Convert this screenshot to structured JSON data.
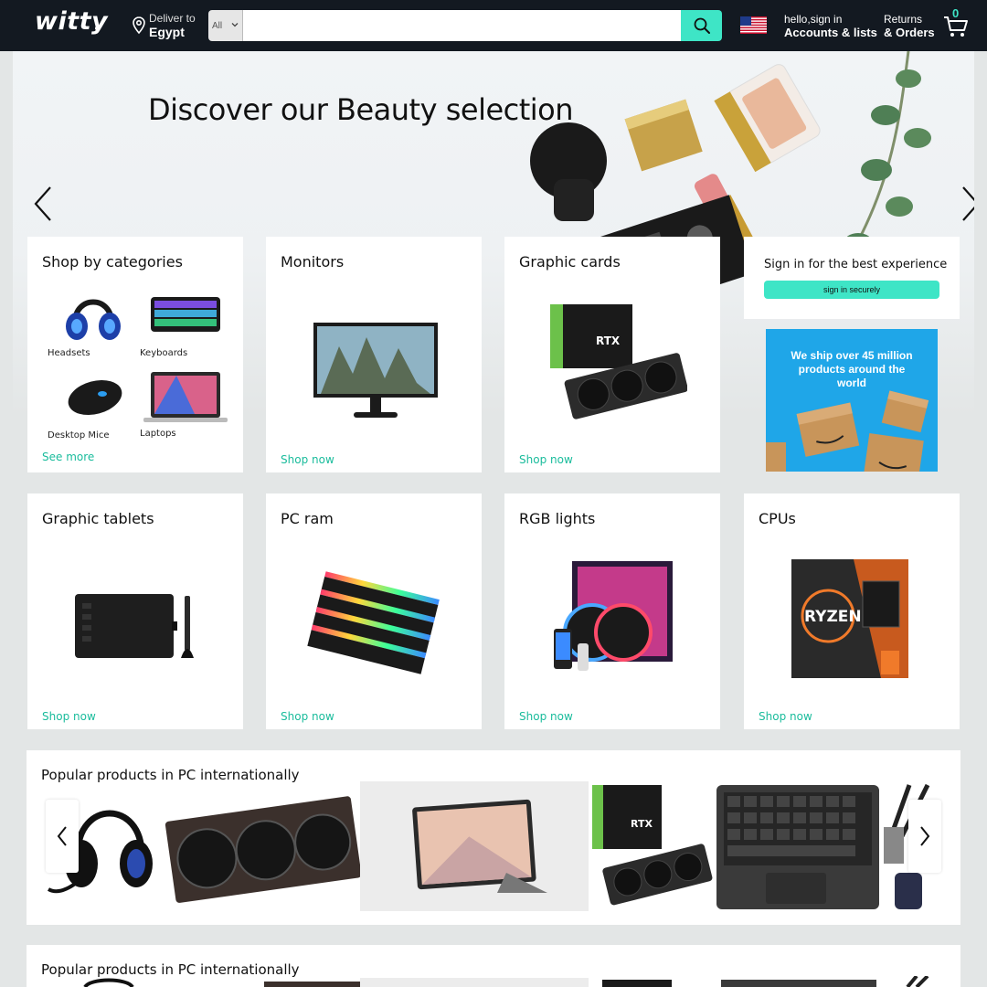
{
  "header": {
    "logo": "witty",
    "deliver_line1": "Deliver to",
    "deliver_line2": "Egypt",
    "search_category": "All",
    "search_placeholder": "",
    "account_line1": "hello,sign in",
    "account_line2": "Accounts & lists",
    "returns_line1": "Returns",
    "returns_line2": "& Orders",
    "cart_count": "0",
    "accent_color": "#3ee5c6"
  },
  "hero": {
    "title": "Discover our Beauty selection"
  },
  "categories_card": {
    "title": "Shop by categories",
    "items": [
      {
        "label": "Headsets",
        "icon": "headset-icon"
      },
      {
        "label": "Keyboards",
        "icon": "keyboard-icon"
      },
      {
        "label": "Desktop Mice",
        "icon": "mouse-icon"
      },
      {
        "label": "Laptops",
        "icon": "laptop-icon"
      }
    ],
    "see_more": "See more"
  },
  "cards": [
    {
      "title": "Monitors",
      "cta": "Shop now"
    },
    {
      "title": "Graphic cards",
      "cta": "Shop now"
    },
    {
      "title": "Graphic tablets",
      "cta": "Shop now"
    },
    {
      "title": "PC ram",
      "cta": "Shop now"
    },
    {
      "title": "RGB lights",
      "cta": "Shop now"
    },
    {
      "title": "CPUs",
      "cta": "Shop now"
    }
  ],
  "signin_box": {
    "title": "Sign in for the best experience",
    "button": "sign in securely"
  },
  "ship_ad": {
    "text": "We ship over 45 million products around the world"
  },
  "carousels": [
    {
      "title": "Popular products in PC internationally"
    },
    {
      "title": "Popular products in PC internationally"
    }
  ]
}
